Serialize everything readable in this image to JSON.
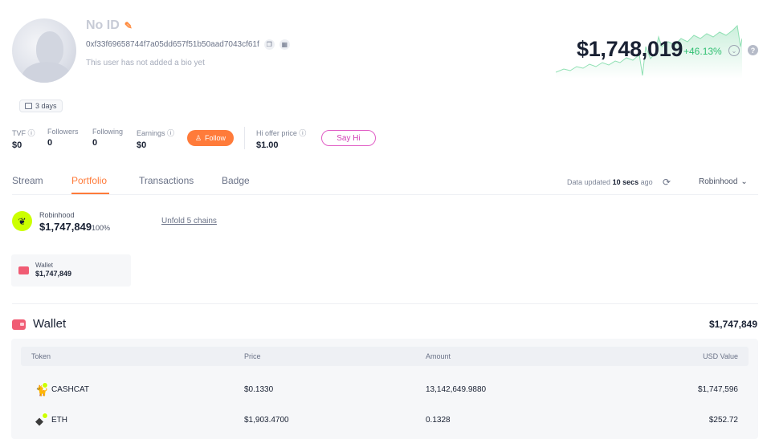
{
  "profile": {
    "username": "No ID",
    "address": "0xf33f69658744f7a05dd657f51b50aad7043cf61f",
    "bio": "This user has not added a bio yet",
    "net_worth": "$1,748,019",
    "change": "+46.13%",
    "age_badge": "3 days"
  },
  "stats": {
    "tvf_label": "TVF",
    "tvf_value": "$0",
    "followers_label": "Followers",
    "followers_value": "0",
    "following_label": "Following",
    "following_value": "0",
    "earnings_label": "Earnings",
    "earnings_value": "$0",
    "follow_label": "Follow",
    "hi_offer_label": "Hi offer price",
    "hi_offer_value": "$1.00",
    "say_hi_label": "Say Hi"
  },
  "tabs": [
    {
      "label": "Stream"
    },
    {
      "label": "Portfolio"
    },
    {
      "label": "Transactions"
    },
    {
      "label": "Badge"
    }
  ],
  "active_tab": "Portfolio",
  "toolbar": {
    "data_updated_prefix": "Data updated",
    "data_updated_time": "10 secs",
    "data_updated_suffix": "ago",
    "chain_selected": "Robinhood"
  },
  "portfolio": {
    "chain_name": "Robinhood",
    "chain_value": "$1,747,849",
    "chain_pct": "100%",
    "unfold_label": "Unfold 5 chains",
    "wallet_card_name": "Wallet",
    "wallet_card_value": "$1,747,849"
  },
  "wallet": {
    "title": "Wallet",
    "total": "$1,747,849",
    "columns": [
      "Token",
      "Price",
      "Amount",
      "USD Value"
    ],
    "rows": [
      {
        "token": "CASHCAT",
        "price": "$0.1330",
        "amount": "13,142,649.9880",
        "usd": "$1,747,596"
      },
      {
        "token": "ETH",
        "price": "$1,903.4700",
        "amount": "0.1328",
        "usd": "$252.72"
      }
    ]
  },
  "colors": {
    "accent": "#ff7b3a",
    "positive": "#2fbf71",
    "chain_badge": "#ccff00",
    "wallet_icon": "#f05c74",
    "say_hi": "#d13fb6"
  }
}
